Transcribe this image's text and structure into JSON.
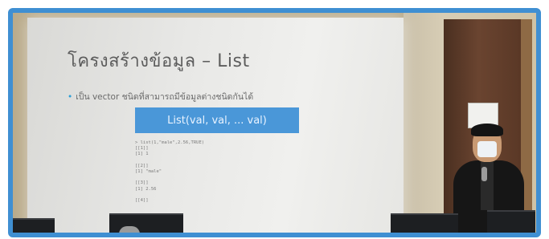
{
  "slide": {
    "title": "โครงสร้างข้อมูล – List",
    "bullet": "เป็น vector ชนิดที่สามารถมีข้อมูลต่างชนิดกันได้",
    "box_text": "List(val, val, ... val)",
    "code": "> list(1,\"male\",2.56,TRUE)\n[[1]]\n[1] 1\n\n[[2]]\n[1] \"male\"\n\n[[3]]\n[1] 2.56\n\n[[4]]"
  },
  "colors": {
    "frame_border": "#3f8fd2",
    "slide_box": "#4a97d8"
  }
}
